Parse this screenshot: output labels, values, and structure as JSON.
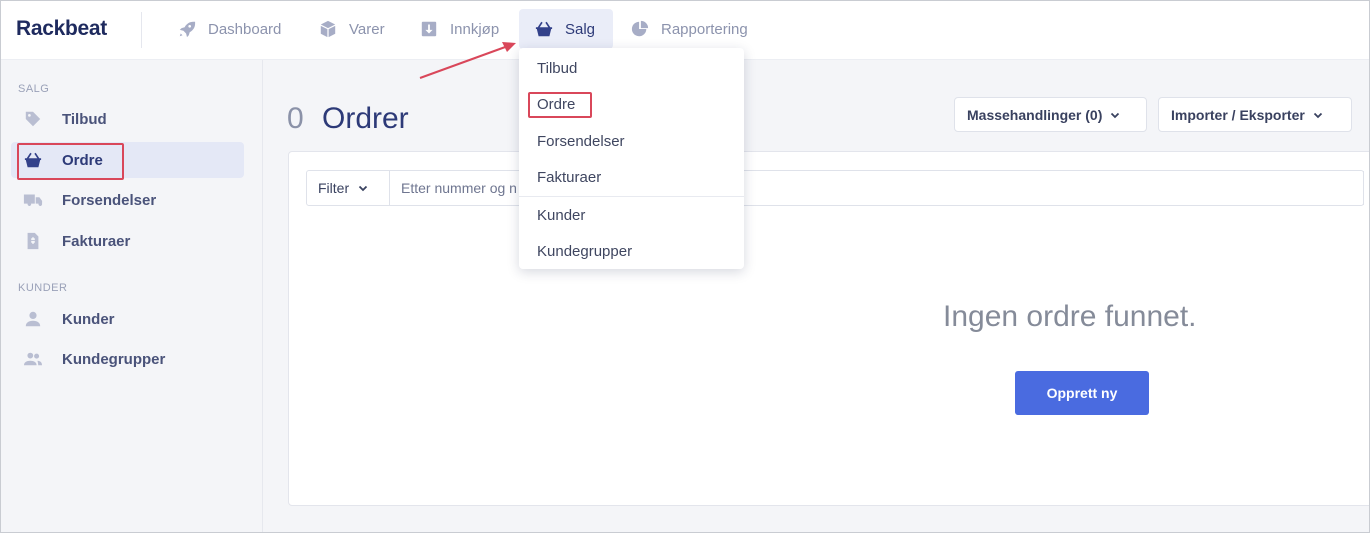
{
  "app": {
    "logo": "Rackbeat"
  },
  "nav": {
    "items": [
      {
        "label": "Dashboard",
        "icon": "rocket-icon"
      },
      {
        "label": "Varer",
        "icon": "box-icon"
      },
      {
        "label": "Innkjøp",
        "icon": "download-icon"
      },
      {
        "label": "Salg",
        "icon": "basket-icon",
        "active": true
      },
      {
        "label": "Rapportering",
        "icon": "pie-chart-icon"
      }
    ]
  },
  "sidebar": {
    "sections": [
      {
        "title": "SALG",
        "items": [
          {
            "label": "Tilbud",
            "icon": "tag-icon"
          },
          {
            "label": "Ordre",
            "icon": "basket-icon",
            "active": true
          },
          {
            "label": "Forsendelser",
            "icon": "truck-icon"
          },
          {
            "label": "Fakturaer",
            "icon": "invoice-icon"
          }
        ]
      },
      {
        "title": "KUNDER",
        "items": [
          {
            "label": "Kunder",
            "icon": "user-icon"
          },
          {
            "label": "Kundegrupper",
            "icon": "users-icon"
          }
        ]
      }
    ]
  },
  "main": {
    "count": "0",
    "title": "Ordrer",
    "bulk_actions": "Massehandlinger (0)",
    "import_export": "Importer / Eksporter",
    "filter_label": "Filter",
    "search_placeholder": "Etter nummer og n",
    "empty_text": "Ingen ordre funnet.",
    "create_button": "Opprett ny"
  },
  "dropdown": {
    "items": [
      "Tilbud",
      "Ordre",
      "Forsendelser",
      "Fakturaer",
      "Kunder",
      "Kundegrupper"
    ]
  },
  "colors": {
    "accent": "#4a6be0",
    "brand_dark": "#2d3a78",
    "annotation": "#d9475a"
  }
}
